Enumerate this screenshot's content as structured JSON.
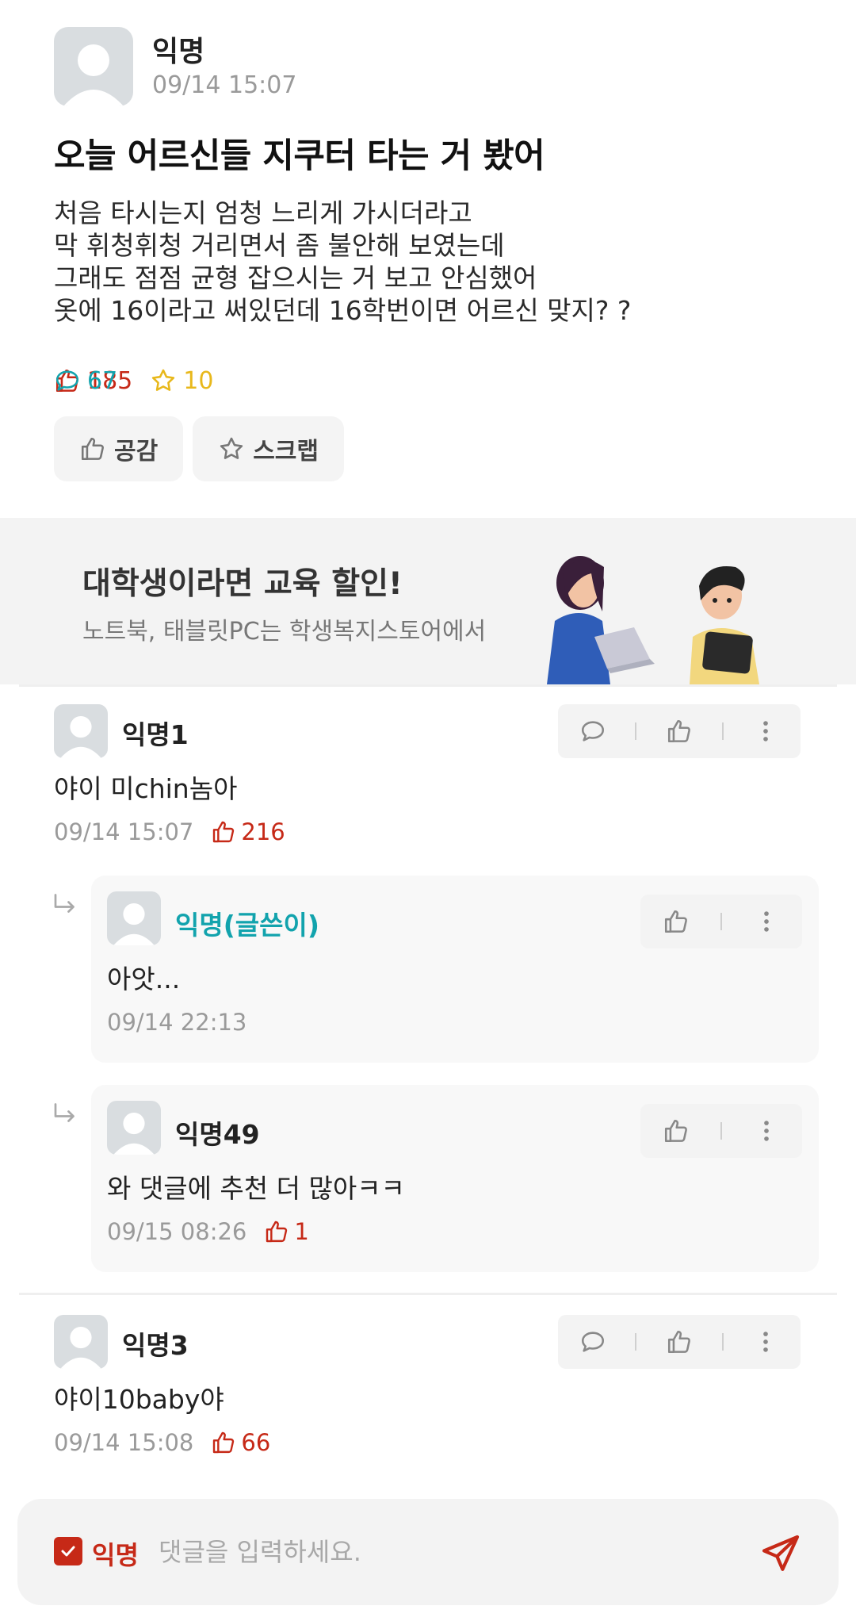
{
  "post": {
    "author": "익명",
    "time": "09/14 15:07",
    "title": "오늘 어르신들 지쿠터 타는 거 봤어",
    "body_lines": [
      "처음 타시는지 엄청 느리게 가시더라고",
      "막 휘청휘청 거리면서 좀 불안해 보였는데",
      "그래도 점점 균형 잡으시는 거 보고 안심했어",
      "옷에 16이라고 써있던데 16학번이면 어르신 맞지? ?"
    ],
    "stats": {
      "likes": "185",
      "comments": "67",
      "scraps": "10"
    },
    "buttons": {
      "like_label": "공감",
      "scrap_label": "스크랩"
    }
  },
  "banner": {
    "title": "대학생이라면 교육 할인!",
    "subtitle": "노트북, 태블릿PC는 학생복지스토어에서"
  },
  "comments": [
    {
      "author": "익명1",
      "text": "야이 미chin놈아",
      "time": "09/14 15:07",
      "likes": "216"
    },
    {
      "author": "익명3",
      "text": "야이10baby야",
      "time": "09/14 15:08",
      "likes": "66"
    }
  ],
  "replies": [
    {
      "author": "익명(글쓴이)",
      "text": "아앗...",
      "time": "09/14 22:13"
    },
    {
      "author": "익명49",
      "text": "와 댓글에 추천 더 많아ㅋㅋ",
      "time": "09/15 08:26",
      "likes": "1"
    }
  ],
  "input": {
    "anon_label": "익명",
    "placeholder": "댓글을 입력하세요."
  },
  "colors": {
    "accent": "#c62917",
    "teal": "#12a3ad",
    "gold": "#e8b81b"
  }
}
